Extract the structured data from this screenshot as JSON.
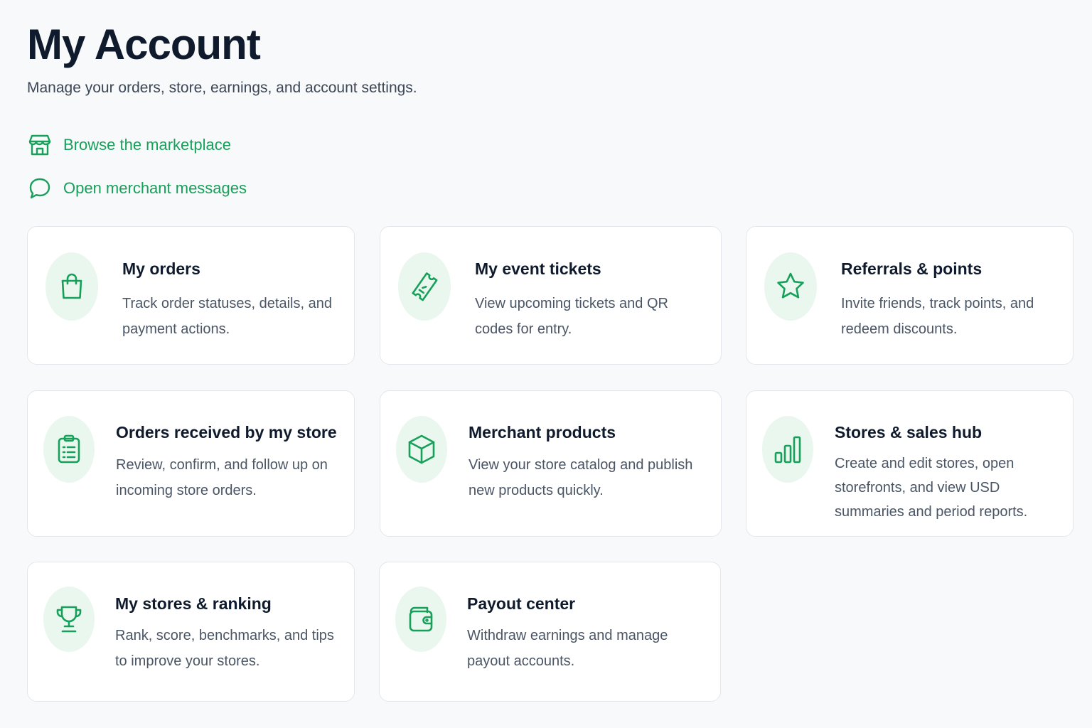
{
  "header": {
    "title": "My Account",
    "subtitle": "Manage your orders, store, earnings, and account settings."
  },
  "quick_links": [
    {
      "label": "Browse the marketplace",
      "icon": "storefront-icon"
    },
    {
      "label": "Open merchant messages",
      "icon": "chat-bubble-icon"
    }
  ],
  "cards": [
    {
      "title": "My orders",
      "description": "Track order statuses, details, and payment actions.",
      "icon": "shopping-bag-icon"
    },
    {
      "title": "My event tickets",
      "description": "View upcoming tickets and QR codes for entry.",
      "icon": "ticket-icon"
    },
    {
      "title": "Referrals & points",
      "description": "Invite friends, track points, and redeem discounts.",
      "icon": "star-icon"
    },
    {
      "title": "Orders received by my store",
      "description": "Review, confirm, and follow up on incoming store orders.",
      "icon": "clipboard-list-icon"
    },
    {
      "title": "Merchant products",
      "description": "View your store catalog and publish new products quickly.",
      "icon": "box-icon"
    },
    {
      "title": "Stores & sales hub",
      "description": "Create and edit stores, open storefronts, and view USD summaries and period reports.",
      "icon": "bar-chart-icon"
    },
    {
      "title": "My stores & ranking",
      "description": "Rank, score, benchmarks, and tips to improve your stores.",
      "icon": "trophy-icon"
    },
    {
      "title": "Payout center",
      "description": "Withdraw earnings and manage payout accounts.",
      "icon": "wallet-icon"
    }
  ],
  "colors": {
    "accent": "#16a05a",
    "icon_bg": "#eaf7ef",
    "title": "#0f1b2d",
    "body_text": "#4a5565",
    "page_bg": "#f8f9fb",
    "card_border": "#e3e7ec"
  }
}
